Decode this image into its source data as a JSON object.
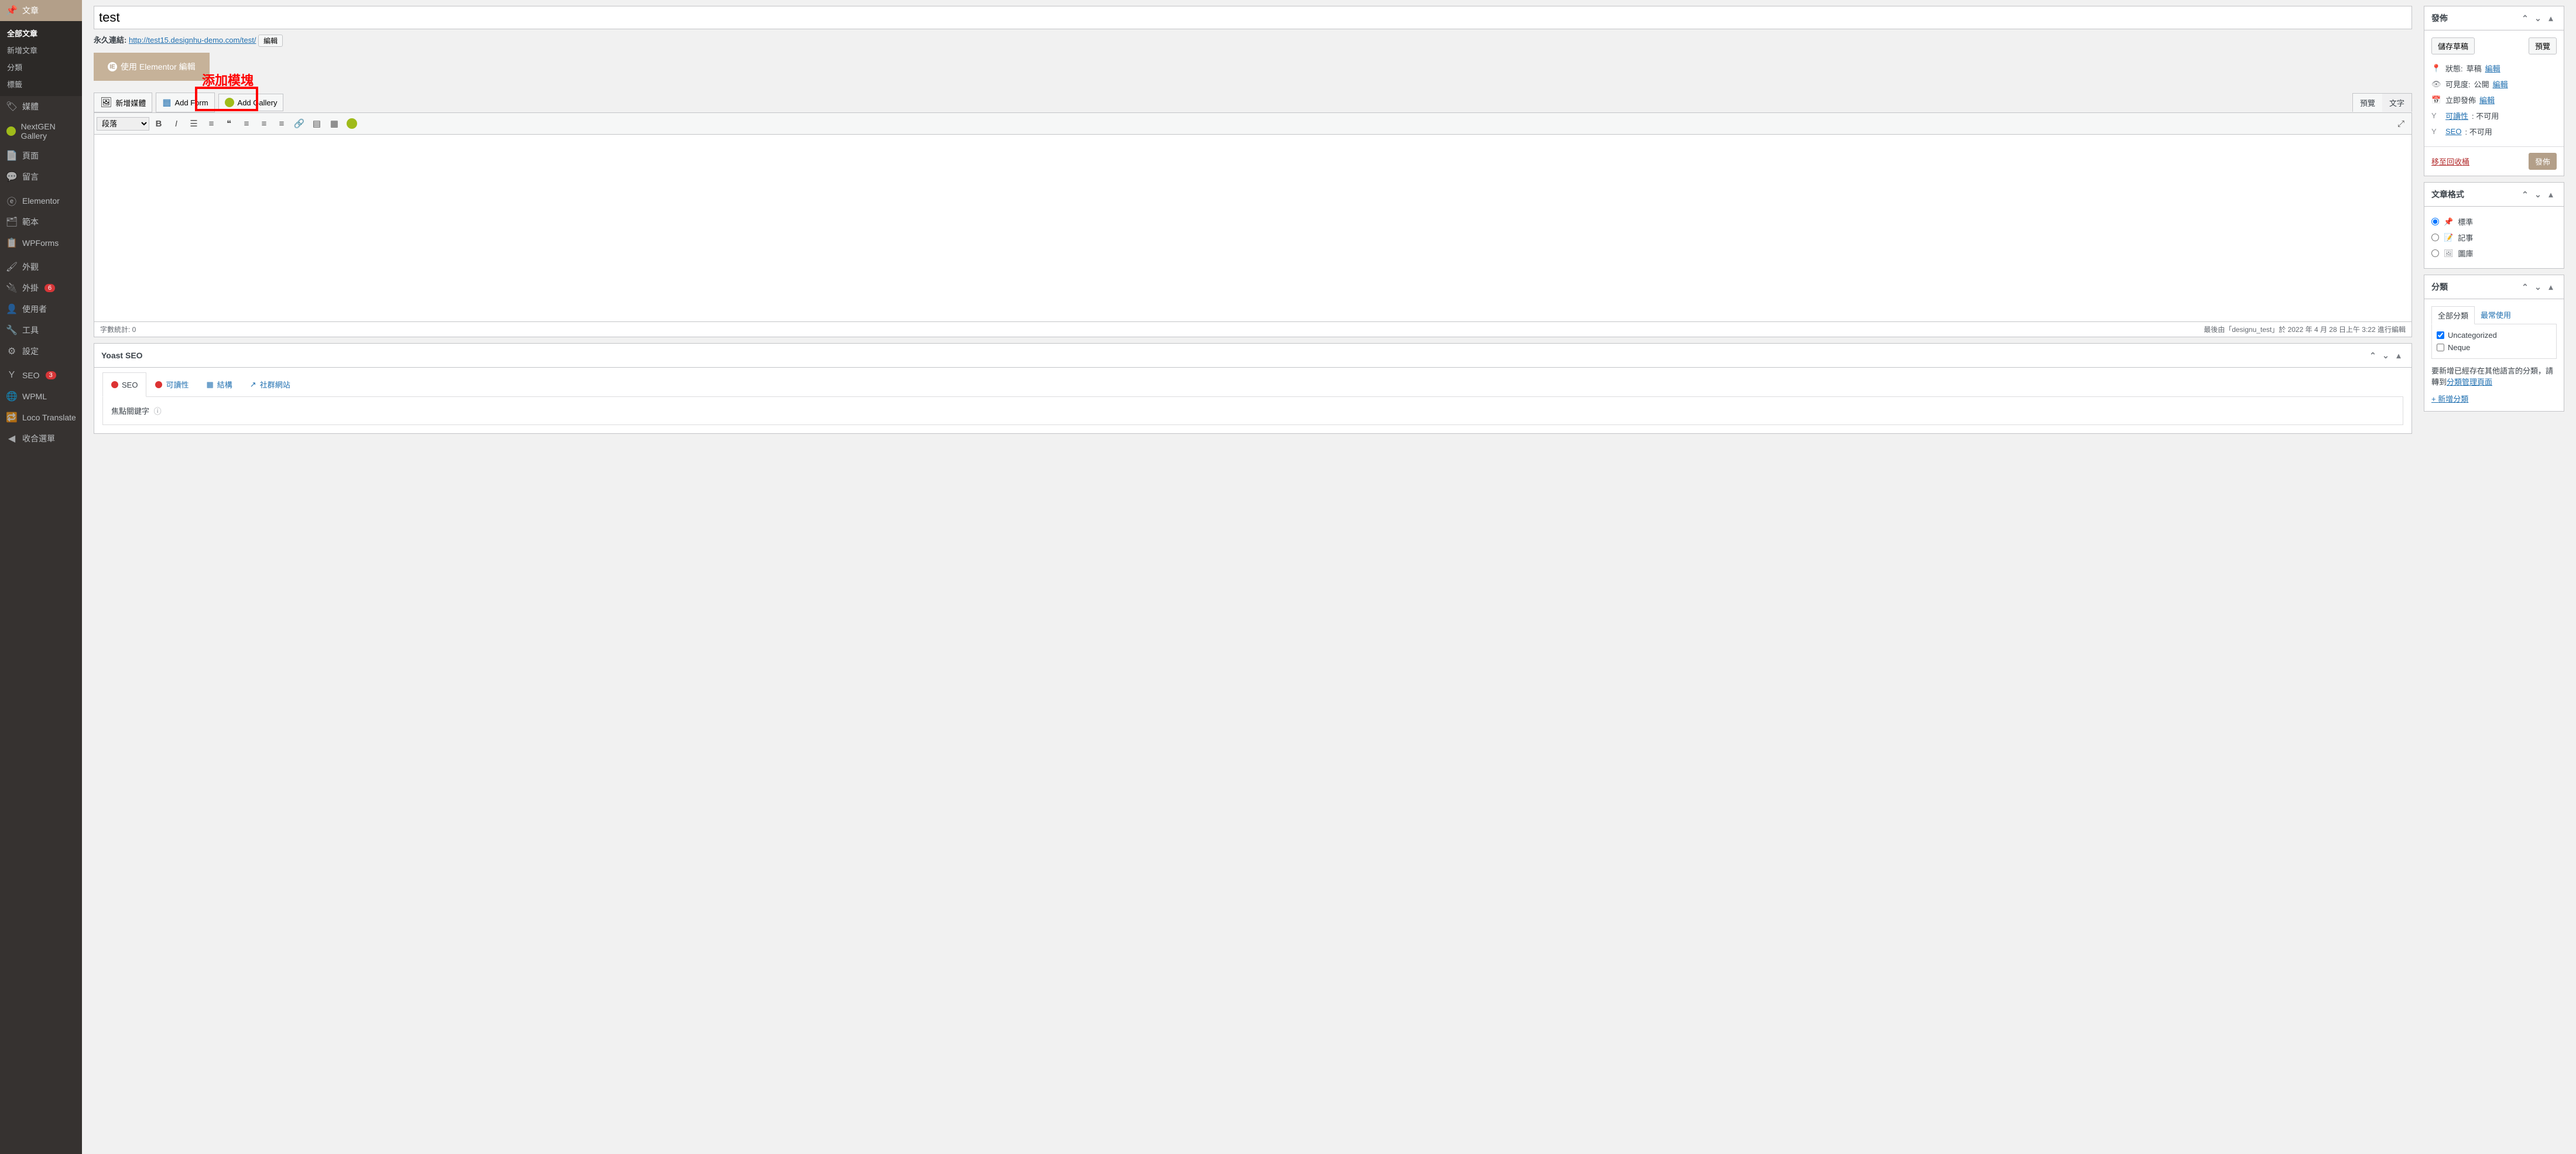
{
  "sidebar": {
    "posts": {
      "label": "文章",
      "all": "全部文章",
      "new": "新增文章",
      "cats": "分類",
      "tags": "標籤"
    },
    "media": "媒體",
    "nextgen": "NextGEN Gallery",
    "pages": "頁面",
    "comments": "留言",
    "elementor": "Elementor",
    "templates": "範本",
    "wpforms": "WPForms",
    "appearance": "外觀",
    "plugins": "外掛",
    "plugins_count": "6",
    "users": "使用者",
    "tools": "工具",
    "settings": "設定",
    "seo": "SEO",
    "seo_count": "3",
    "wpml": "WPML",
    "loco": "Loco Translate",
    "collapse": "收合選單"
  },
  "editor": {
    "title_value": "test",
    "permalink_label": "永久連結:",
    "permalink_url": "http://test15.designhu-demo.com/test/",
    "permalink_edit": "編輯",
    "elementor_btn": "使用 Elementor 編輯",
    "add_media": "新增媒體",
    "add_form": "Add Form",
    "add_gallery": "Add Gallery",
    "annotation": "添加模塊",
    "tab_visual": "預覽",
    "tab_text": "文字",
    "format_select": "段落",
    "word_count_label": "字數統計: ",
    "word_count": "0",
    "last_edit": "最後由「designu_test」於 2022 年 4 月 28 日上午 3:22 進行編輯"
  },
  "publish": {
    "title": "發佈",
    "save_draft": "儲存草稿",
    "preview": "預覽",
    "status_label": "狀態:",
    "status_value": "草稿",
    "visibility_label": "可見度:",
    "visibility_value": "公開",
    "schedule_label": "立即發佈",
    "readability_label": "可讀性",
    "readability_value": ": 不可用",
    "seo_label": "SEO",
    "seo_value": ": 不可用",
    "edit": "編輯",
    "trash": "移至回收桶",
    "publish_btn": "發佈"
  },
  "format": {
    "title": "文章格式",
    "standard": "標準",
    "aside": "記事",
    "gallery": "圖庫"
  },
  "categories": {
    "title": "分類",
    "tab_all": "全部分類",
    "tab_pop": "最常使用",
    "items": [
      "Uncategorized",
      "Neque"
    ],
    "note_prefix": "要新增已經存在其他語言的分類，請轉到",
    "note_link": "分類管理頁面",
    "add_new": "+ 新增分類"
  },
  "yoast": {
    "title": "Yoast SEO",
    "tab_seo": "SEO",
    "tab_read": "可讀性",
    "tab_schema": "結構",
    "tab_social": "社群網站",
    "focus_kw": "焦點關鍵字"
  }
}
